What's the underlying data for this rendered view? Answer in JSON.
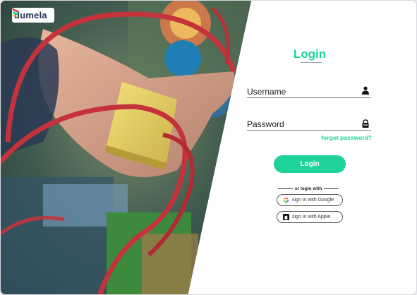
{
  "brand": {
    "name": "dumela"
  },
  "login": {
    "title": "Login",
    "username_label": "Username",
    "password_label": "Password",
    "forgot_label": "forgot password?",
    "submit_label": "Login",
    "divider_text": "or login with",
    "google_label": "sign in with Google",
    "apple_label": "sign in with Apple"
  },
  "icons": {
    "username": "user-icon",
    "password": "lock-icon",
    "google": "google-icon",
    "apple": "apple-icon"
  },
  "colors": {
    "accent": "#1ad69a",
    "brand_text": "#243057"
  }
}
